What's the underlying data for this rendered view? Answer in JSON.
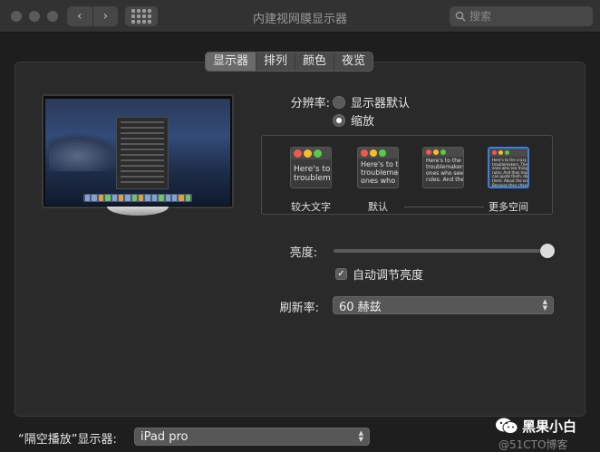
{
  "window": {
    "title": "内建视网膜显示器"
  },
  "search": {
    "placeholder": "搜索"
  },
  "nav": {
    "back": "‹",
    "forward": "›"
  },
  "tabs": [
    {
      "label": "显示器",
      "active": true
    },
    {
      "label": "排列",
      "active": false
    },
    {
      "label": "颜色",
      "active": false
    },
    {
      "label": "夜览",
      "active": false
    }
  ],
  "resolution": {
    "label": "分辨率:",
    "options": [
      {
        "label": "显示器默认",
        "selected": false
      },
      {
        "label": "缩放",
        "selected": true
      }
    ]
  },
  "scaling": {
    "options": [
      {
        "label": "较大文字",
        "preview": "Here's to\ntroublem",
        "selected": false
      },
      {
        "label": "默认",
        "preview": "Here's to t\ntroublema\nones who",
        "selected": false
      },
      {
        "label": "",
        "preview": "Here's to the c\ntroublemakers.\nones who see t\nrules. And they",
        "selected": false
      },
      {
        "label": "更多空间",
        "preview": "Here's to the crazy one\ntroublemakers. The rou\nones who see things dif\nrules. And they have no\ncan quote them, disagre\nthem. About the only th\nBecause they change th",
        "selected": true
      }
    ]
  },
  "brightness": {
    "label": "亮度:",
    "level": 1.0
  },
  "auto_brightness": {
    "label": "自动调节亮度",
    "checked": true
  },
  "refresh": {
    "label": "刷新率:",
    "value": "60 赫兹"
  },
  "airplay": {
    "label": "“隔空播放”显示器:",
    "value": "iPad pro"
  },
  "watermark": {
    "title": "黑果小白",
    "sub": "@51CTO博客"
  },
  "colors": {
    "accent": "#3b7fe0",
    "window_bg": "#1e1e1e",
    "panel_bg": "#2a2a2a"
  }
}
